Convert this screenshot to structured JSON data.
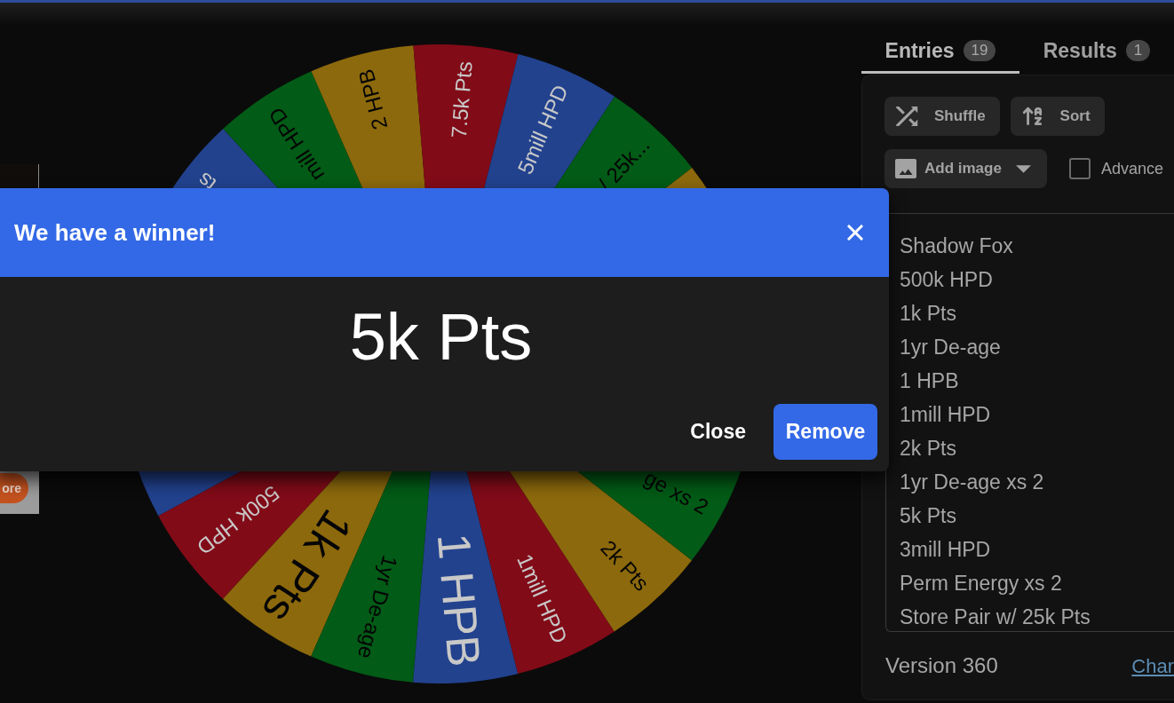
{
  "promo": {
    "button": "ore"
  },
  "wheel": {
    "segments": [
      {
        "color": "#22428e",
        "label": "ts"
      },
      {
        "color": "#025b16",
        "label": "mill HPD"
      },
      {
        "color": "#8c690c",
        "label": "2 HPB"
      },
      {
        "color": "#820b18",
        "label": "7.5k Pts"
      },
      {
        "color": "#22428e",
        "label": "5mill HPD"
      },
      {
        "color": "#025b16",
        "label": "/ 25k..."
      },
      {
        "color": "#8c690c"
      },
      {
        "color": "#22428e"
      },
      {
        "color": "#820b18",
        "label": "500k HPD"
      },
      {
        "color": "#8c690c",
        "label": "1k Pts"
      },
      {
        "color": "#025b16",
        "label": "1yr De-age"
      },
      {
        "color": "#22428e",
        "label": "1 HPB"
      },
      {
        "color": "#820b18",
        "label": "1mill HPD"
      },
      {
        "color": "#8c690c",
        "label": "2k Pts"
      },
      {
        "color": "#025b16",
        "label": "ge xs 2"
      }
    ]
  },
  "sidebar": {
    "tabs": [
      {
        "label": "Entries",
        "count": "19",
        "selected": true
      },
      {
        "label": "Results",
        "count": "1",
        "selected": false
      }
    ],
    "buttons": [
      "Shuffle",
      "Sort"
    ],
    "image_button": "Add image",
    "advanced": {
      "label": "Advance",
      "checked": false
    },
    "entries": [
      "Shadow Fox",
      "500k HPD",
      "1k Pts",
      "1yr De-age",
      "1 HPB",
      "1mill HPD",
      "2k Pts",
      "1yr De-age xs 2",
      "5k Pts",
      "3mill HPD",
      "Perm Energy xs 2",
      "Store Pair w/ 25k Pts"
    ],
    "version": "Version 360",
    "link": "Char"
  },
  "dialog": {
    "title": "We have a winner!",
    "winner": "5k Pts",
    "buttons": [
      {
        "label": "Close",
        "kind": "text"
      },
      {
        "label": "Remove",
        "kind": "primary"
      }
    ]
  }
}
